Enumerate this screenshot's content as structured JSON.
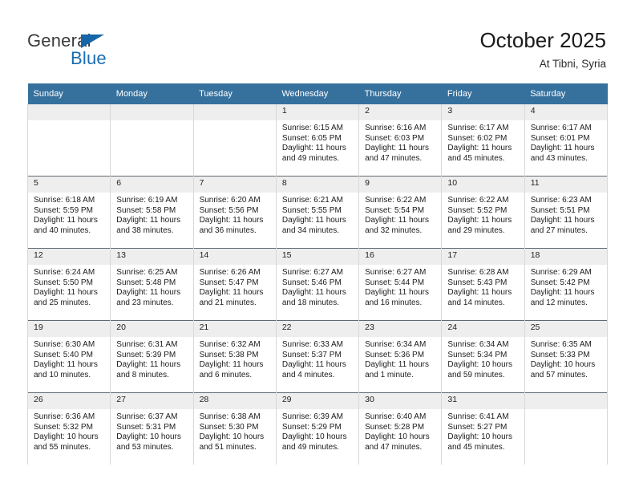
{
  "brand": {
    "name_top": "General",
    "name_bottom": "Blue",
    "color_top": "#3c3c3b",
    "color_bottom": "#1b6cb3",
    "triangle_color": "#1565a8"
  },
  "header": {
    "title": "October 2025",
    "subtitle": "At Tibni, Syria"
  },
  "theme": {
    "header_bg": "#36719e",
    "header_text": "#ffffff",
    "daynum_band_bg": "#eeeeee",
    "row_rule": "#5f6a72",
    "cell_border": "#d8d8d8"
  },
  "calendar": {
    "weekday_headers": [
      "Sunday",
      "Monday",
      "Tuesday",
      "Wednesday",
      "Thursday",
      "Friday",
      "Saturday"
    ],
    "weeks": [
      [
        {
          "empty": true
        },
        {
          "empty": true
        },
        {
          "empty": true
        },
        {
          "day": "1",
          "sunrise": "Sunrise: 6:15 AM",
          "sunset": "Sunset: 6:05 PM",
          "daylight_1": "Daylight: 11 hours",
          "daylight_2": "and 49 minutes."
        },
        {
          "day": "2",
          "sunrise": "Sunrise: 6:16 AM",
          "sunset": "Sunset: 6:03 PM",
          "daylight_1": "Daylight: 11 hours",
          "daylight_2": "and 47 minutes."
        },
        {
          "day": "3",
          "sunrise": "Sunrise: 6:17 AM",
          "sunset": "Sunset: 6:02 PM",
          "daylight_1": "Daylight: 11 hours",
          "daylight_2": "and 45 minutes."
        },
        {
          "day": "4",
          "sunrise": "Sunrise: 6:17 AM",
          "sunset": "Sunset: 6:01 PM",
          "daylight_1": "Daylight: 11 hours",
          "daylight_2": "and 43 minutes."
        }
      ],
      [
        {
          "day": "5",
          "sunrise": "Sunrise: 6:18 AM",
          "sunset": "Sunset: 5:59 PM",
          "daylight_1": "Daylight: 11 hours",
          "daylight_2": "and 40 minutes."
        },
        {
          "day": "6",
          "sunrise": "Sunrise: 6:19 AM",
          "sunset": "Sunset: 5:58 PM",
          "daylight_1": "Daylight: 11 hours",
          "daylight_2": "and 38 minutes."
        },
        {
          "day": "7",
          "sunrise": "Sunrise: 6:20 AM",
          "sunset": "Sunset: 5:56 PM",
          "daylight_1": "Daylight: 11 hours",
          "daylight_2": "and 36 minutes."
        },
        {
          "day": "8",
          "sunrise": "Sunrise: 6:21 AM",
          "sunset": "Sunset: 5:55 PM",
          "daylight_1": "Daylight: 11 hours",
          "daylight_2": "and 34 minutes."
        },
        {
          "day": "9",
          "sunrise": "Sunrise: 6:22 AM",
          "sunset": "Sunset: 5:54 PM",
          "daylight_1": "Daylight: 11 hours",
          "daylight_2": "and 32 minutes."
        },
        {
          "day": "10",
          "sunrise": "Sunrise: 6:22 AM",
          "sunset": "Sunset: 5:52 PM",
          "daylight_1": "Daylight: 11 hours",
          "daylight_2": "and 29 minutes."
        },
        {
          "day": "11",
          "sunrise": "Sunrise: 6:23 AM",
          "sunset": "Sunset: 5:51 PM",
          "daylight_1": "Daylight: 11 hours",
          "daylight_2": "and 27 minutes."
        }
      ],
      [
        {
          "day": "12",
          "sunrise": "Sunrise: 6:24 AM",
          "sunset": "Sunset: 5:50 PM",
          "daylight_1": "Daylight: 11 hours",
          "daylight_2": "and 25 minutes."
        },
        {
          "day": "13",
          "sunrise": "Sunrise: 6:25 AM",
          "sunset": "Sunset: 5:48 PM",
          "daylight_1": "Daylight: 11 hours",
          "daylight_2": "and 23 minutes."
        },
        {
          "day": "14",
          "sunrise": "Sunrise: 6:26 AM",
          "sunset": "Sunset: 5:47 PM",
          "daylight_1": "Daylight: 11 hours",
          "daylight_2": "and 21 minutes."
        },
        {
          "day": "15",
          "sunrise": "Sunrise: 6:27 AM",
          "sunset": "Sunset: 5:46 PM",
          "daylight_1": "Daylight: 11 hours",
          "daylight_2": "and 18 minutes."
        },
        {
          "day": "16",
          "sunrise": "Sunrise: 6:27 AM",
          "sunset": "Sunset: 5:44 PM",
          "daylight_1": "Daylight: 11 hours",
          "daylight_2": "and 16 minutes."
        },
        {
          "day": "17",
          "sunrise": "Sunrise: 6:28 AM",
          "sunset": "Sunset: 5:43 PM",
          "daylight_1": "Daylight: 11 hours",
          "daylight_2": "and 14 minutes."
        },
        {
          "day": "18",
          "sunrise": "Sunrise: 6:29 AM",
          "sunset": "Sunset: 5:42 PM",
          "daylight_1": "Daylight: 11 hours",
          "daylight_2": "and 12 minutes."
        }
      ],
      [
        {
          "day": "19",
          "sunrise": "Sunrise: 6:30 AM",
          "sunset": "Sunset: 5:40 PM",
          "daylight_1": "Daylight: 11 hours",
          "daylight_2": "and 10 minutes."
        },
        {
          "day": "20",
          "sunrise": "Sunrise: 6:31 AM",
          "sunset": "Sunset: 5:39 PM",
          "daylight_1": "Daylight: 11 hours",
          "daylight_2": "and 8 minutes."
        },
        {
          "day": "21",
          "sunrise": "Sunrise: 6:32 AM",
          "sunset": "Sunset: 5:38 PM",
          "daylight_1": "Daylight: 11 hours",
          "daylight_2": "and 6 minutes."
        },
        {
          "day": "22",
          "sunrise": "Sunrise: 6:33 AM",
          "sunset": "Sunset: 5:37 PM",
          "daylight_1": "Daylight: 11 hours",
          "daylight_2": "and 4 minutes."
        },
        {
          "day": "23",
          "sunrise": "Sunrise: 6:34 AM",
          "sunset": "Sunset: 5:36 PM",
          "daylight_1": "Daylight: 11 hours",
          "daylight_2": "and 1 minute."
        },
        {
          "day": "24",
          "sunrise": "Sunrise: 6:34 AM",
          "sunset": "Sunset: 5:34 PM",
          "daylight_1": "Daylight: 10 hours",
          "daylight_2": "and 59 minutes."
        },
        {
          "day": "25",
          "sunrise": "Sunrise: 6:35 AM",
          "sunset": "Sunset: 5:33 PM",
          "daylight_1": "Daylight: 10 hours",
          "daylight_2": "and 57 minutes."
        }
      ],
      [
        {
          "day": "26",
          "sunrise": "Sunrise: 6:36 AM",
          "sunset": "Sunset: 5:32 PM",
          "daylight_1": "Daylight: 10 hours",
          "daylight_2": "and 55 minutes."
        },
        {
          "day": "27",
          "sunrise": "Sunrise: 6:37 AM",
          "sunset": "Sunset: 5:31 PM",
          "daylight_1": "Daylight: 10 hours",
          "daylight_2": "and 53 minutes."
        },
        {
          "day": "28",
          "sunrise": "Sunrise: 6:38 AM",
          "sunset": "Sunset: 5:30 PM",
          "daylight_1": "Daylight: 10 hours",
          "daylight_2": "and 51 minutes."
        },
        {
          "day": "29",
          "sunrise": "Sunrise: 6:39 AM",
          "sunset": "Sunset: 5:29 PM",
          "daylight_1": "Daylight: 10 hours",
          "daylight_2": "and 49 minutes."
        },
        {
          "day": "30",
          "sunrise": "Sunrise: 6:40 AM",
          "sunset": "Sunset: 5:28 PM",
          "daylight_1": "Daylight: 10 hours",
          "daylight_2": "and 47 minutes."
        },
        {
          "day": "31",
          "sunrise": "Sunrise: 6:41 AM",
          "sunset": "Sunset: 5:27 PM",
          "daylight_1": "Daylight: 10 hours",
          "daylight_2": "and 45 minutes."
        },
        {
          "empty": true
        }
      ]
    ]
  }
}
